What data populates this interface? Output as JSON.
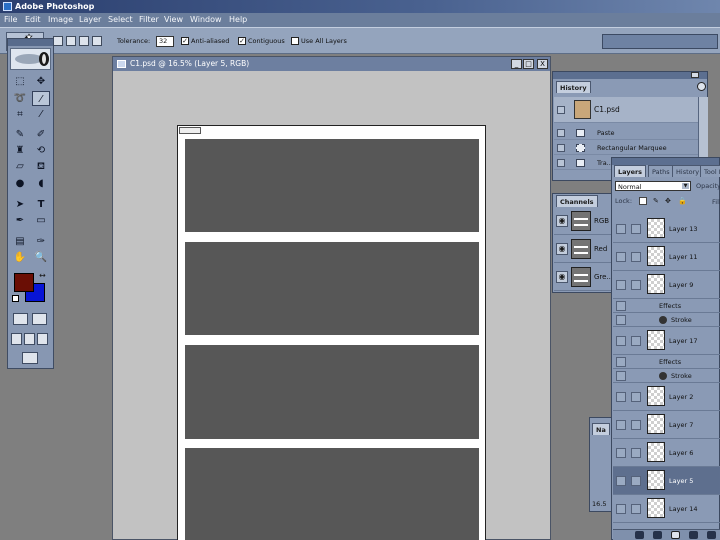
{
  "app": {
    "title": "Adobe Photoshop",
    "menu": [
      "File",
      "Edit",
      "Image",
      "Layer",
      "Select",
      "Filter",
      "View",
      "Window",
      "Help"
    ]
  },
  "options_bar": {
    "tolerance_label": "Tolerance:",
    "tolerance_value": "32",
    "anti_aliased_label": "Anti-aliased",
    "anti_aliased_checked": true,
    "contiguous_label": "Contiguous",
    "contiguous_checked": true,
    "use_all_layers_label": "Use All Layers",
    "use_all_layers_checked": false
  },
  "toolbox": {
    "foreground_color": "#6a0e05",
    "background_color": "#0714d6",
    "active_tool": "magic-wand"
  },
  "document": {
    "title": "C1.psd @ 16.5% (Layer 5, RGB)",
    "min_label": "_",
    "max_label": "□",
    "close_label": "X",
    "canvas_color": "#ffffff",
    "panel_color": "#575757"
  },
  "history": {
    "tab": "History",
    "snapshot": "C1.psd",
    "items": [
      "Paste",
      "Rectangular Marquee",
      "Tra..."
    ]
  },
  "channels": {
    "tab": "Channels",
    "items": [
      "RGB",
      "Red",
      "Gre..."
    ]
  },
  "layers": {
    "tabs": [
      "Layers",
      "Paths",
      "History",
      "Tool Presets"
    ],
    "blend_mode": "Normal",
    "opacity_label": "Opacity:",
    "lock_label": "Lock:",
    "fill_label": "Fill:",
    "effects_label": "Effects",
    "stroke_label": "Stroke",
    "rows": [
      {
        "kind": "layer",
        "name": "Layer 13",
        "selected": false
      },
      {
        "kind": "layer",
        "name": "Layer 11",
        "selected": false
      },
      {
        "kind": "layer",
        "name": "Layer 9",
        "selected": false
      },
      {
        "kind": "effects",
        "name": "Effects"
      },
      {
        "kind": "stroke",
        "name": "Stroke"
      },
      {
        "kind": "layer",
        "name": "Layer 17",
        "selected": false
      },
      {
        "kind": "effects",
        "name": "Effects"
      },
      {
        "kind": "stroke",
        "name": "Stroke"
      },
      {
        "kind": "layer",
        "name": "Layer 2",
        "selected": false
      },
      {
        "kind": "layer",
        "name": "Layer 7",
        "selected": false
      },
      {
        "kind": "layer",
        "name": "Layer 6",
        "selected": false
      },
      {
        "kind": "layer",
        "name": "Layer 5",
        "selected": true
      },
      {
        "kind": "layer",
        "name": "Layer 14",
        "selected": false
      }
    ]
  },
  "navigator": {
    "tab": "Na",
    "zoom": "16.5"
  }
}
